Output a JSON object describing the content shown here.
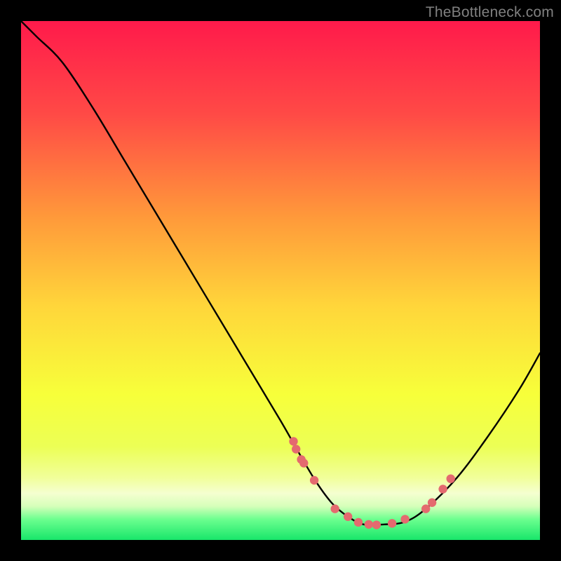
{
  "watermark": "TheBottleneck.com",
  "colors": {
    "gradient_top": "#ff1a4b",
    "gradient_mid_upper": "#ff7a3a",
    "gradient_mid": "#ffd63a",
    "gradient_mid_lower": "#f7ff3a",
    "gradient_low": "#f2ff57",
    "gradient_band": "#e9ff8f",
    "gradient_bottom": "#2cff7a",
    "curve": "#000000",
    "dots": "#e46a6f"
  },
  "chart_data": {
    "type": "line",
    "title": "",
    "xlabel": "",
    "ylabel": "",
    "xlim": [
      0,
      100
    ],
    "ylim": [
      0,
      100
    ],
    "series": [
      {
        "name": "bottleneck-curve",
        "x": [
          0,
          3,
          8,
          14,
          20,
          26,
          32,
          38,
          44,
          50,
          54,
          57,
          60,
          63,
          66,
          70,
          74,
          78,
          84,
          90,
          96,
          100
        ],
        "values": [
          100,
          97,
          92,
          83,
          73,
          63,
          53,
          43,
          33,
          23,
          16,
          11,
          7,
          4.5,
          3,
          3,
          3.5,
          6,
          12,
          20,
          29,
          36
        ]
      }
    ],
    "markers": {
      "name": "highlight-dots",
      "x": [
        52.5,
        53,
        54,
        54.5,
        56.5,
        60.5,
        63,
        65,
        67,
        68.5,
        71.5,
        74,
        78,
        79.2,
        81.3,
        82.8
      ],
      "values": [
        19,
        17.5,
        15.5,
        14.8,
        11.5,
        6,
        4.5,
        3.4,
        3,
        2.9,
        3.2,
        4,
        6,
        7.2,
        9.8,
        11.8
      ]
    }
  }
}
